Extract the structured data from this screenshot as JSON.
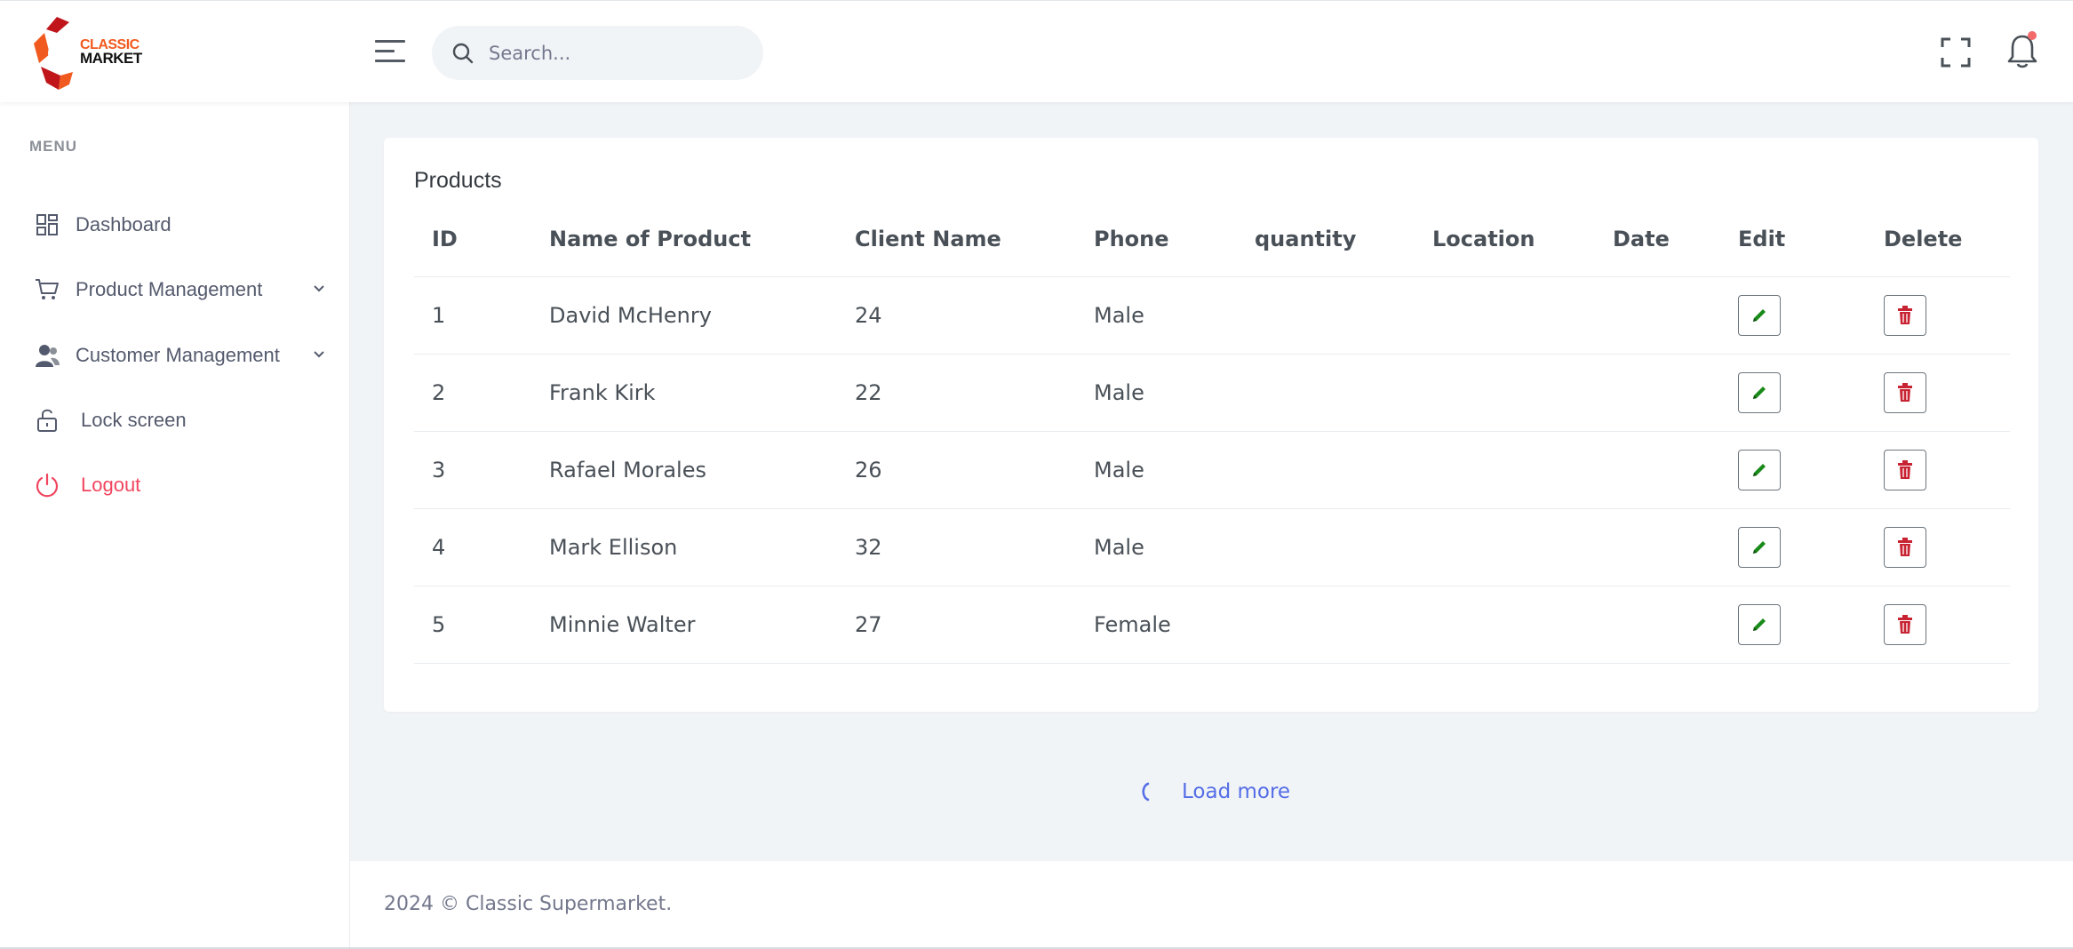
{
  "brand": {
    "line1": "CLASSIC",
    "line2": "MARKET",
    "accent": "#f15a1f",
    "dark_red": "#c0151b"
  },
  "header": {
    "search_placeholder": "Search...",
    "notification_dot_color": "#f46a6a"
  },
  "sidebar": {
    "menu_title": "MENU",
    "items": [
      {
        "label": "Dashboard",
        "icon": "dashboard-icon"
      },
      {
        "label": "Product Management",
        "icon": "cart-icon",
        "expandable": true
      },
      {
        "label": "Customer Management",
        "icon": "users-icon",
        "expandable": true
      },
      {
        "label": "Lock screen",
        "icon": "unlock-icon"
      },
      {
        "label": "Logout",
        "icon": "power-icon",
        "color": "#f1455f"
      }
    ]
  },
  "products": {
    "title": "Products",
    "columns": [
      "ID",
      "Name of Product",
      "Client Name",
      "Phone",
      "quantity",
      "Location",
      "Date",
      "Edit",
      "Delete"
    ],
    "rows": [
      {
        "id": "1",
        "name": "David McHenry",
        "client": "24",
        "phone": "Male",
        "quantity": "",
        "location": "",
        "date": ""
      },
      {
        "id": "2",
        "name": "Frank Kirk",
        "client": "22",
        "phone": "Male",
        "quantity": "",
        "location": "",
        "date": ""
      },
      {
        "id": "3",
        "name": "Rafael Morales",
        "client": "26",
        "phone": "Male",
        "quantity": "",
        "location": "",
        "date": ""
      },
      {
        "id": "4",
        "name": "Mark Ellison",
        "client": "32",
        "phone": "Male",
        "quantity": "",
        "location": "",
        "date": ""
      },
      {
        "id": "5",
        "name": "Minnie Walter",
        "client": "27",
        "phone": "Female",
        "quantity": "",
        "location": "",
        "date": ""
      }
    ],
    "edit_color": "#1a8a1a",
    "delete_color": "#c82333"
  },
  "load_more": {
    "label": "Load more",
    "color": "#556ee6"
  },
  "footer": {
    "text": "2024 © Classic Supermarket."
  }
}
